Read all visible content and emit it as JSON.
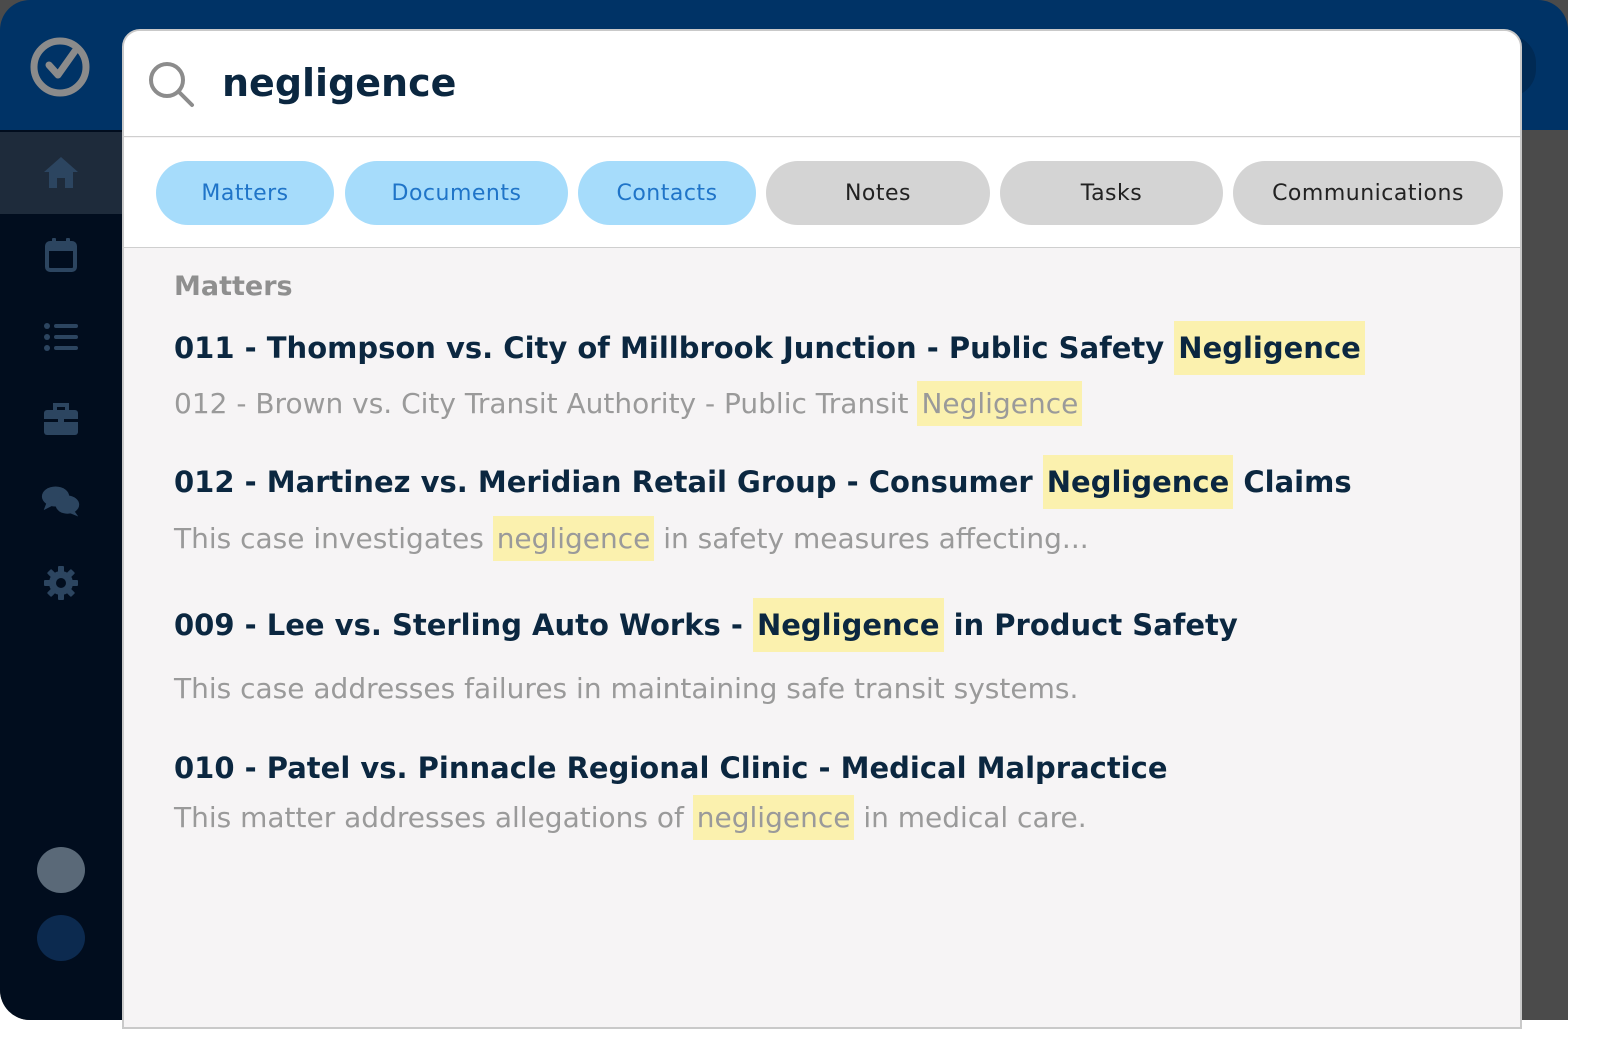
{
  "search": {
    "query": "negligence"
  },
  "filters": [
    {
      "label": "Matters",
      "active": true
    },
    {
      "label": "Documents",
      "active": true
    },
    {
      "label": "Contacts",
      "active": true
    },
    {
      "label": "Notes",
      "active": false
    },
    {
      "label": "Tasks",
      "active": false
    },
    {
      "label": "Communications",
      "active": false
    }
  ],
  "sidebar": {
    "items": [
      {
        "icon": "home-icon"
      },
      {
        "icon": "calendar-icon"
      },
      {
        "icon": "list-icon"
      },
      {
        "icon": "briefcase-icon"
      },
      {
        "icon": "chat-icon"
      },
      {
        "icon": "gear-icon"
      }
    ]
  },
  "results": {
    "heading": "Matters",
    "items": [
      {
        "title_before": "011 - Thompson vs. City of Millbrook Junction - Public Safety ",
        "title_hl": "Negligence",
        "title_after": "",
        "sub_before": "012 - Brown vs. City Transit Authority - Public Transit ",
        "sub_hl": "Negligence",
        "sub_after": ""
      },
      {
        "title_before": "012 - Martinez vs. Meridian Retail Group - Consumer ",
        "title_hl": "Negligence",
        "title_after": " Claims",
        "sub_before": "This case investigates ",
        "sub_hl": "negligence",
        "sub_after": " in safety measures affecting..."
      },
      {
        "title_before": "009 - Lee vs. Sterling Auto Works - ",
        "title_hl": "Negligence",
        "title_after": " in Product Safety",
        "sub_before": "This case addresses failures in maintaining safe transit systems.",
        "sub_hl": "",
        "sub_after": ""
      },
      {
        "title_before": "010 - Patel vs. Pinnacle Regional Clinic - Medical Malpractice",
        "title_hl": "",
        "title_after": "",
        "sub_before": "This matter addresses allegations of ",
        "sub_hl": "negligence",
        "sub_after": " in medical care."
      }
    ]
  },
  "colors": {
    "header": "#003366",
    "sidebar": "#010d1e",
    "active_filter_bg": "#a6dcfb",
    "active_filter_text": "#1f74c8",
    "inactive_filter_bg": "#d4d4d4",
    "highlight": "#fbf1ae",
    "title_text": "#0b2740"
  }
}
